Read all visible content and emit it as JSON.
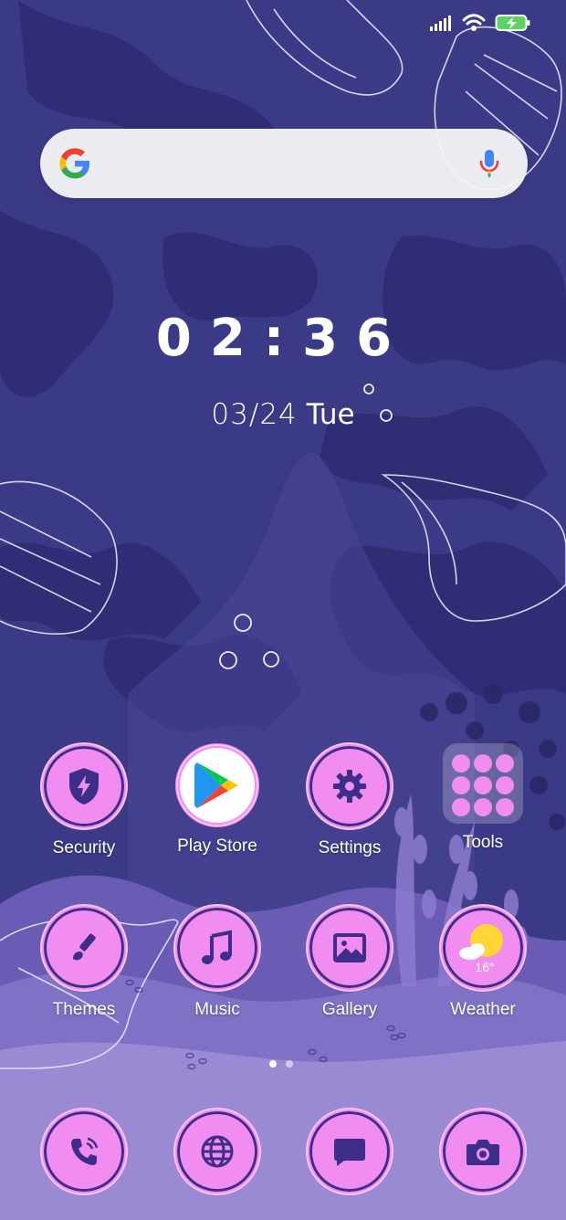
{
  "clock": {
    "time": "02:36"
  },
  "date": {
    "date": "03/24",
    "weekday": "Tue"
  },
  "search": {
    "placeholder": ""
  },
  "apps_row1": [
    {
      "label": "Security",
      "icon": "shield-bolt-icon"
    },
    {
      "label": "Play Store",
      "icon": "play-store-icon"
    },
    {
      "label": "Settings",
      "icon": "gear-icon"
    },
    {
      "label": "Tools",
      "icon": "folder-icon"
    }
  ],
  "apps_row2": [
    {
      "label": "Themes",
      "icon": "paintbrush-icon"
    },
    {
      "label": "Music",
      "icon": "music-note-icon"
    },
    {
      "label": "Gallery",
      "icon": "image-icon"
    },
    {
      "label": "Weather",
      "icon": "weather-icon",
      "temp": "16°"
    }
  ],
  "dock": [
    {
      "icon": "phone-icon"
    },
    {
      "icon": "globe-icon"
    },
    {
      "icon": "message-icon"
    },
    {
      "icon": "camera-icon"
    }
  ],
  "colors": {
    "background": "#3b3a86",
    "accent": "#f18cf0",
    "icon_glyph": "#3d2e8a",
    "sea_floor": "#9a8ad4"
  }
}
